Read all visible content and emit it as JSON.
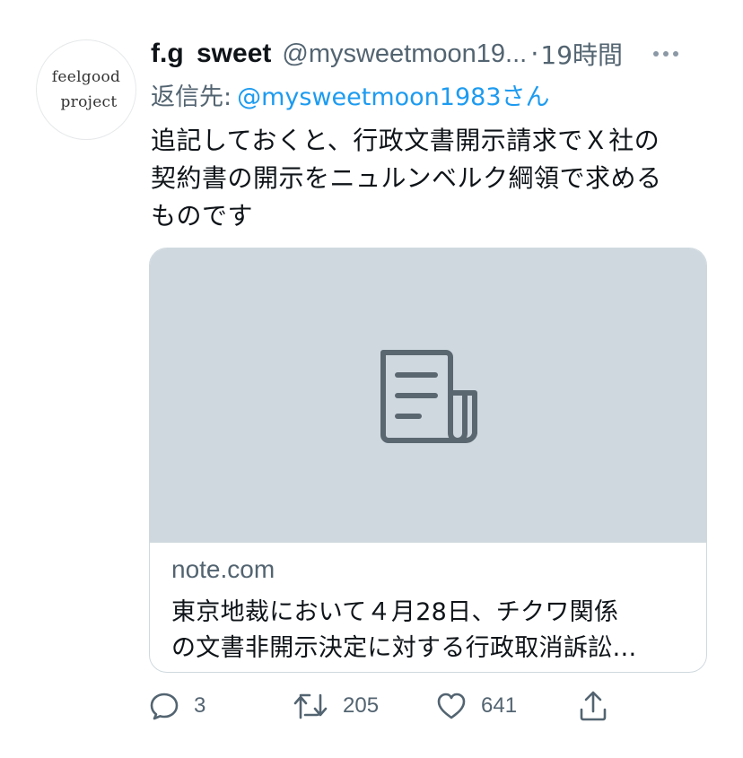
{
  "tweet": {
    "avatar": {
      "line1": "feelgood",
      "line2": "project"
    },
    "author_name": "f.g  sweet",
    "handle": "@mysweetmoon19...",
    "separator": "·",
    "time": "19時間",
    "reply_prefix": "返信先:",
    "reply_to": "@mysweetmoon1983さん",
    "text_lines": [
      "追記しておくと、行政文書開示請求でＸ社の",
      "契約書の開示をニュルンベルク綱領で求める",
      "ものです"
    ],
    "card": {
      "media_icon": "document-icon",
      "domain": "note.com",
      "title_lines": [
        "東京地裁において４月28日、チクワ関係",
        "の文書非開示決定に対する行政取消訴訟…"
      ]
    },
    "actions": {
      "reply_count": "3",
      "retweet_count": "205",
      "like_count": "641"
    },
    "colors": {
      "text": "#0f1419",
      "secondary": "#536471",
      "link": "#1d9bf0",
      "card_media_bg": "#cfd8df",
      "border": "#cfd9de"
    }
  }
}
